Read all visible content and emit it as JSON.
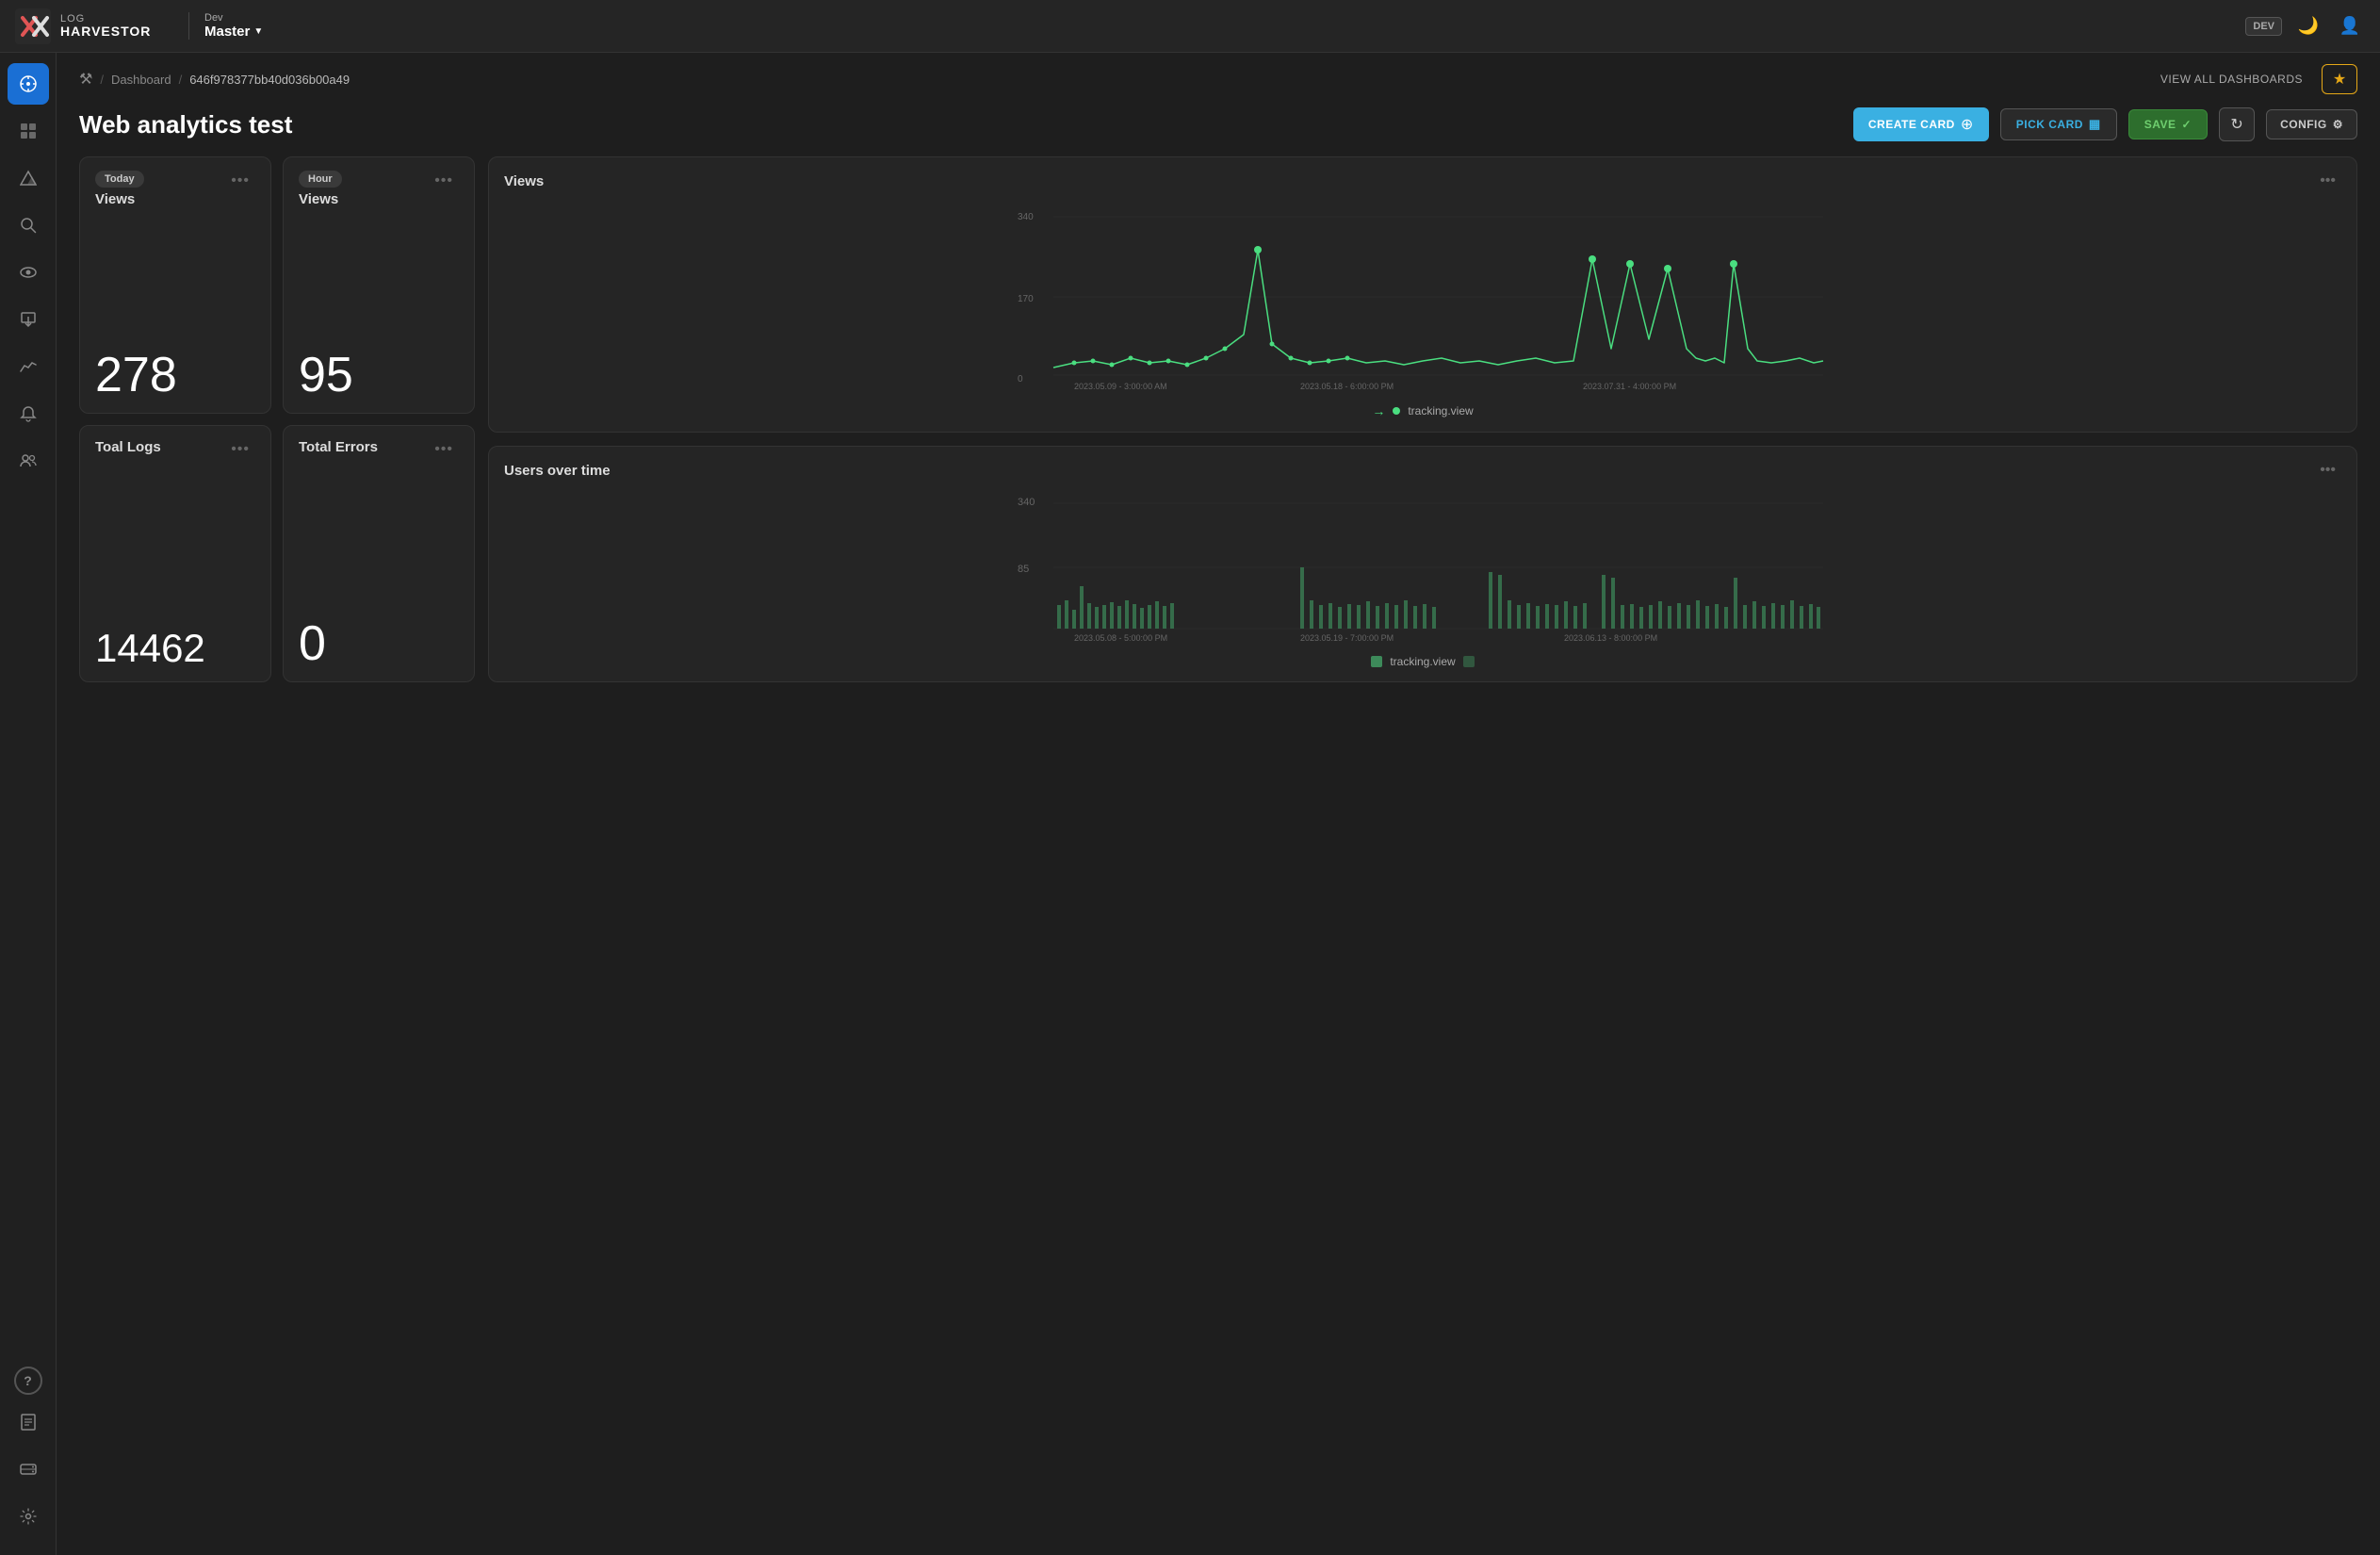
{
  "app": {
    "logo_line1": "LOG",
    "logo_line2": "HARVESTOR",
    "env_label": "Dev",
    "env_value": "Master",
    "nav_badge": "DEV"
  },
  "breadcrumb": {
    "home_icon": "⚒",
    "dashboard_label": "Dashboard",
    "id_label": "646f978377bb40d036b00a49",
    "view_all_label": "VIEW ALL DASHBOARDS"
  },
  "page": {
    "title": "Web analytics test"
  },
  "toolbar": {
    "create_card_label": "CREATE CARD",
    "pick_card_label": "PICK CARD",
    "save_label": "SAVE",
    "refresh_label": "↻",
    "config_label": "CONFIG"
  },
  "stat_cards": [
    {
      "badge": "Today",
      "title": "Views",
      "value": "278"
    },
    {
      "badge": "Hour",
      "title": "Views",
      "value": "95"
    },
    {
      "title": "Toal Logs",
      "value": "14462"
    },
    {
      "title": "Total Errors",
      "value": "0"
    }
  ],
  "chart_views": {
    "title": "Views",
    "y_labels": [
      "340",
      "170",
      "0"
    ],
    "x_labels": [
      "2023.05.09 - 3:00:00 AM",
      "2023.05.18 - 6:00:00 PM",
      "2023.07.31 - 4:00:00 PM"
    ],
    "legend_label": "tracking.view",
    "legend_type": "dot",
    "color": "#4ade80"
  },
  "chart_users": {
    "title": "Users over time",
    "y_labels": [
      "340",
      "85"
    ],
    "x_labels": [
      "2023.05.08 - 5:00:00 PM",
      "2023.05.19 - 7:00:00 PM",
      "2023.06.13 - 8:00:00 PM"
    ],
    "legend_label": "tracking.view",
    "legend_type": "square",
    "color": "#4ade80"
  },
  "sidebar": {
    "items": [
      {
        "icon": "◎",
        "label": "dashboard",
        "active": true
      },
      {
        "icon": "▦",
        "label": "grid"
      },
      {
        "icon": "⛰",
        "label": "alerts"
      },
      {
        "icon": "⊕",
        "label": "search"
      },
      {
        "icon": "◉",
        "label": "observe"
      },
      {
        "icon": "⬒",
        "label": "import"
      },
      {
        "icon": "∿",
        "label": "analytics"
      },
      {
        "icon": "🔔",
        "label": "notifications"
      },
      {
        "icon": "👥",
        "label": "users"
      }
    ],
    "bottom_items": [
      {
        "icon": "?",
        "label": "help"
      },
      {
        "icon": "≡",
        "label": "reports"
      },
      {
        "icon": "▬",
        "label": "storage"
      },
      {
        "icon": "⚙",
        "label": "settings"
      }
    ]
  }
}
